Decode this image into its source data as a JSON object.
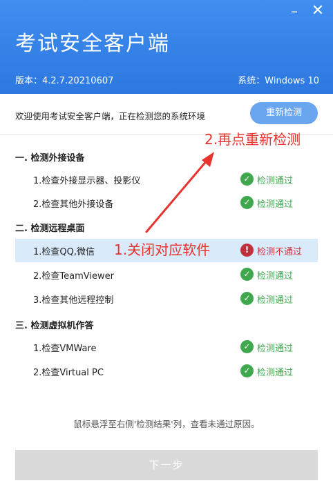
{
  "window": {
    "minimize_label": "–",
    "close_label": "✕"
  },
  "header": {
    "title": "考试安全客户端",
    "version": "版本：4.2.7.20210607",
    "system": "系统：Windows 10"
  },
  "toolbar": {
    "welcome": "欢迎使用考试安全客户端，正在检测您的系统环境",
    "recheck_label": "重新检测"
  },
  "sections": [
    {
      "title": "一. 检测外接设备",
      "items": [
        {
          "label": "1.检查外接显示器、投影仪",
          "status": "pass",
          "status_text": "检测通过",
          "icon": "✓"
        },
        {
          "label": "2.检查其他外接设备",
          "status": "pass",
          "status_text": "检测通过",
          "icon": "✓"
        }
      ]
    },
    {
      "title": "二. 检测远程桌面",
      "items": [
        {
          "label": "1.检查QQ,微信",
          "status": "fail",
          "status_text": "检测不通过",
          "icon": "!"
        },
        {
          "label": "2.检查TeamViewer",
          "status": "pass",
          "status_text": "检测通过",
          "icon": "✓"
        },
        {
          "label": "3.检查其他远程控制",
          "status": "pass",
          "status_text": "检测通过",
          "icon": "✓"
        }
      ]
    },
    {
      "title": "三. 检测虚拟机作答",
      "items": [
        {
          "label": "1.检查VMWare",
          "status": "pass",
          "status_text": "检测通过",
          "icon": "✓"
        },
        {
          "label": "2.检查Virtual PC",
          "status": "pass",
          "status_text": "检测通过",
          "icon": "✓"
        }
      ]
    }
  ],
  "annotations": {
    "step1": "1.关闭对应软件",
    "step2": "2.再点重新检测",
    "color": "#e8322e"
  },
  "footer": {
    "hint": "鼠标悬浮至右侧'检测结果'列，查看未通过原因。",
    "next_label": "下一步"
  }
}
